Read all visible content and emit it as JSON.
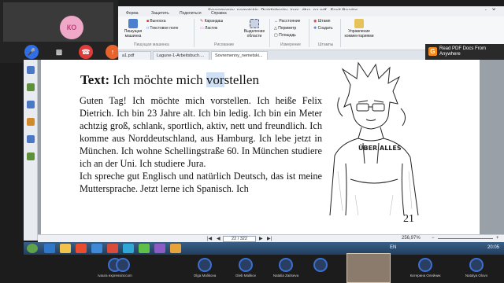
{
  "call": {
    "self_initials": "КО",
    "controls": [
      "mic-icon",
      "camera-off-icon",
      "hang-up-icon",
      "screen-share-icon"
    ],
    "participants": [
      {
        "name": "ivaura expressinccom"
      },
      {
        "name": ""
      },
      {
        "name": "Olga Malikova"
      },
      {
        "name": "Gleb Malikov"
      },
      {
        "name": "Natalia Zaitseva"
      },
      {
        "name": ""
      },
      {
        "name": "Катерина Олейник"
      },
      {
        "name": "Natalya Olovo"
      }
    ]
  },
  "window": {
    "title": "Sovremenny_nemetskiy_Praktichesky_kurs_dlya_na.pdf - Foxit Reader",
    "menu": [
      "Форма",
      "Защитить",
      "Поделиться",
      "Справка"
    ],
    "ribbon": {
      "btn_typewriter": "Пишущая машинка",
      "btn_callout": "Выноска",
      "btn_textbox": "Текстовое поле",
      "group_typewriter": "Пишущая машинка",
      "btn_pencil": "Карандаш",
      "btn_eraser": "Ластик",
      "group_drawing": "Рисование",
      "btn_select_area": "Выделение области",
      "btn_distance": "Расстояние",
      "btn_perimeter": "Периметр",
      "btn_area": "Площадь",
      "group_measure": "Измерение",
      "btn_stamp": "Штамп",
      "btn_create": "Создать",
      "group_stamps": "Штампы",
      "btn_manage_comments": "Управление комментариями"
    },
    "tabs": [
      "a1.pdf",
      "Lagune-1-Arbeitsbuch....",
      "Sovremenny_nemetski..."
    ],
    "banner": "Read PDF Docs From Anywhere",
    "banner_icon": "G"
  },
  "document": {
    "heading_bold": "Text:",
    "heading_pre": "Ich möchte mich ",
    "heading_hl": "vor",
    "heading_post": "stellen",
    "paragraph1": "Guten Tag! Ich möchte mich vorstellen. Ich heiße Felix Dietrich. Ich bin 23 Jahre alt. Ich bin ledig. Ich bin ein Meter achtzig groß, schlank, sportlich, aktiv, nett und freundlich. Ich komme aus Norddeutschland, aus Hamburg. Ich lebe jetzt in München. Ich wohne Schellingstraße 60. In München studiere ich an der Uni. Ich studiere Jura.",
    "paragraph2": "Ich spreche gut Englisch und natürlich Deutsch, das ist meine Muttersprache. Jetzt lerne ich Spanisch. Ich",
    "shirt_text": "ÜBER ALLES",
    "page_number": "21"
  },
  "status": {
    "page_current": "22 / 322",
    "zoom": "256,97%"
  },
  "taskbar": {
    "lang": "EN",
    "time": "20:05"
  }
}
